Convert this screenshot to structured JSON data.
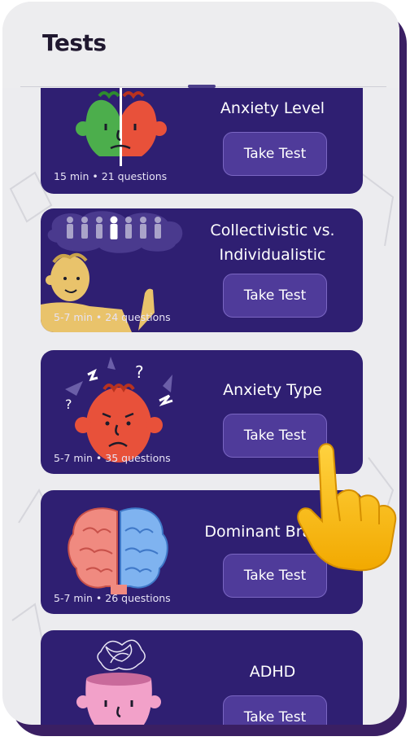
{
  "header": {
    "title": "Tests"
  },
  "tests": [
    {
      "title": "Anxiety Level",
      "button": "Take Test",
      "meta": "15 min • 21 questions",
      "illustration": "split-face-icon"
    },
    {
      "title": "Collectivistic vs. Individualistic",
      "button": "Take Test",
      "meta": "5-7 min • 24 questions",
      "illustration": "thinking-person-icon"
    },
    {
      "title": "Anxiety Type",
      "button": "Take Test",
      "meta": "5-7 min • 35 questions",
      "illustration": "anxious-face-icon"
    },
    {
      "title": "Dominant Brain S",
      "button": "Take Test",
      "meta": "5-7 min • 26 questions",
      "illustration": "brain-halves-icon"
    },
    {
      "title": "ADHD",
      "button": "Take Test",
      "meta": "",
      "illustration": "tangled-thoughts-head-icon"
    }
  ],
  "overlay": {
    "pointer": "pointing-hand-icon"
  },
  "colors": {
    "card": "#2f1f72",
    "button": "#4f3b9a",
    "accent_red": "#e8513a",
    "accent_green": "#4cae4c"
  }
}
